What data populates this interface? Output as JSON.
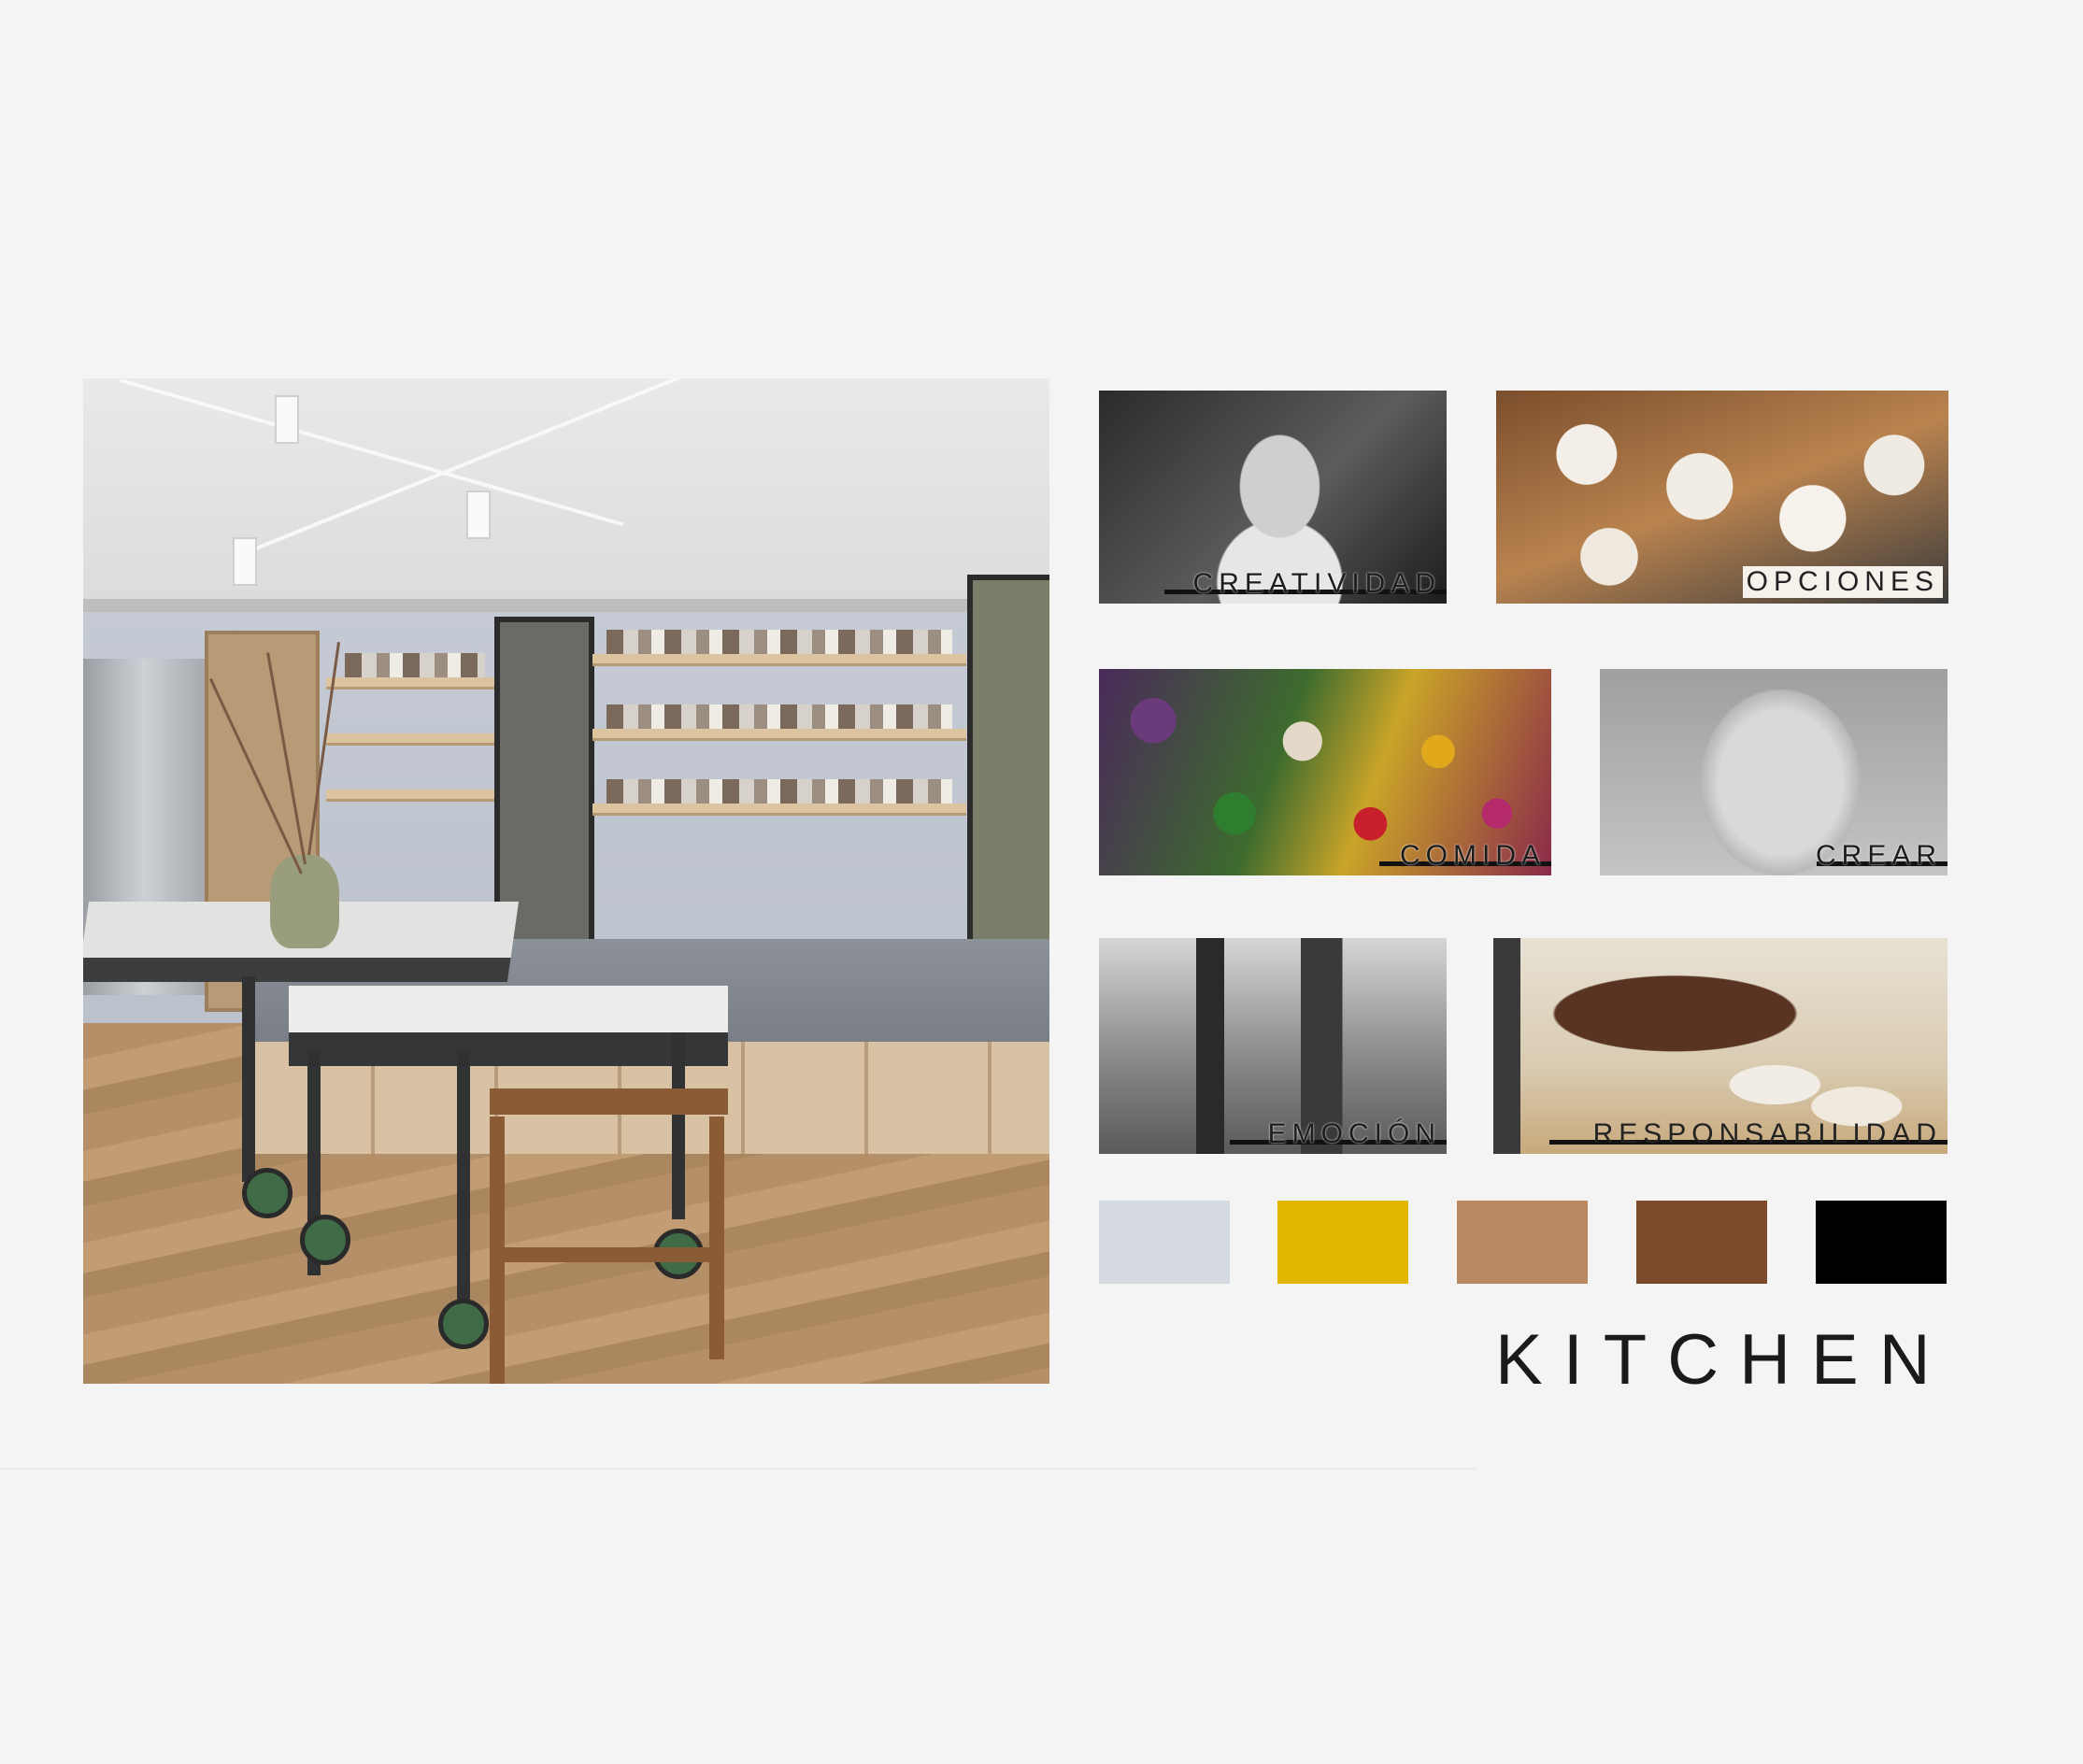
{
  "tiles": [
    {
      "id": "creatividad",
      "caption": "CREATIVIDAD"
    },
    {
      "id": "opciones",
      "caption": "OPCIONES"
    },
    {
      "id": "comida",
      "caption": "COMIDA"
    },
    {
      "id": "crear",
      "caption": "CREAR"
    },
    {
      "id": "emocion",
      "caption": "EMOCIÓN"
    },
    {
      "id": "responsabilidad",
      "caption": "RESPONSABILIDAD"
    }
  ],
  "palette": [
    {
      "name": "light-gray",
      "color": "#d5d9e0"
    },
    {
      "name": "mustard-yellow",
      "color": "#e3b700"
    },
    {
      "name": "tan",
      "color": "#b98a62"
    },
    {
      "name": "walnut-brown",
      "color": "#7b4a28"
    },
    {
      "name": "black",
      "color": "#000000"
    }
  ],
  "title": "KITCHEN"
}
